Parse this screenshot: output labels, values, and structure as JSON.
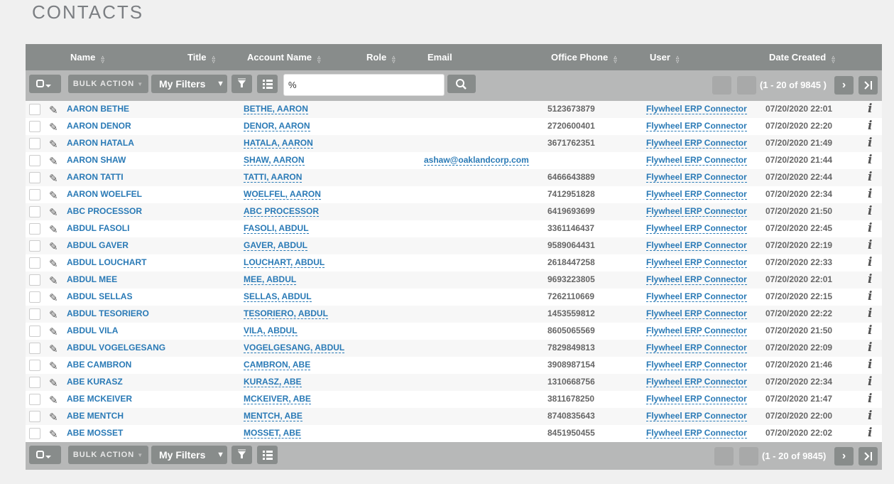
{
  "page": {
    "title": "CONTACTS"
  },
  "columns": [
    "Name",
    "Title",
    "Account Name",
    "Role",
    "Email",
    "Office Phone",
    "User",
    "Date Created"
  ],
  "toolbar": {
    "bulk_action": "BULK ACTION",
    "my_filters": "My Filters",
    "search_value": "%",
    "pagination_top": "(1 - 20 of 9845 )",
    "pagination_bottom": "(1 - 20 of 9845)"
  },
  "rows": [
    {
      "name": "AARON BETHE",
      "account": "BETHE, AARON",
      "email": "",
      "phone": "5123673879",
      "user": "Flywheel ERP Connector",
      "date": "07/20/2020 22:01"
    },
    {
      "name": "AARON DENOR",
      "account": "DENOR, AARON",
      "email": "",
      "phone": "2720600401",
      "user": "Flywheel ERP Connector",
      "date": "07/20/2020 22:20"
    },
    {
      "name": "AARON HATALA",
      "account": "HATALA, AARON",
      "email": "",
      "phone": "3671762351",
      "user": "Flywheel ERP Connector",
      "date": "07/20/2020 21:49"
    },
    {
      "name": "AARON SHAW",
      "account": "SHAW, AARON",
      "email": "ashaw@oaklandcorp.com",
      "phone": "",
      "user": "Flywheel ERP Connector",
      "date": "07/20/2020 21:44"
    },
    {
      "name": "AARON TATTI",
      "account": "TATTI, AARON",
      "email": "",
      "phone": "6466643889",
      "user": "Flywheel ERP Connector",
      "date": "07/20/2020 22:44"
    },
    {
      "name": "AARON WOELFEL",
      "account": "WOELFEL, AARON",
      "email": "",
      "phone": "7412951828",
      "user": "Flywheel ERP Connector",
      "date": "07/20/2020 22:34"
    },
    {
      "name": "ABC PROCESSOR",
      "account": "ABC PROCESSOR",
      "email": "",
      "phone": "6419693699",
      "user": "Flywheel ERP Connector",
      "date": "07/20/2020 21:50"
    },
    {
      "name": "ABDUL FASOLI",
      "account": "FASOLI, ABDUL",
      "email": "",
      "phone": "3361146437",
      "user": "Flywheel ERP Connector",
      "date": "07/20/2020 22:45"
    },
    {
      "name": "ABDUL GAVER",
      "account": "GAVER, ABDUL",
      "email": "",
      "phone": "9589064431",
      "user": "Flywheel ERP Connector",
      "date": "07/20/2020 22:19"
    },
    {
      "name": "ABDUL LOUCHART",
      "account": "LOUCHART, ABDUL",
      "email": "",
      "phone": "2618447258",
      "user": "Flywheel ERP Connector",
      "date": "07/20/2020 22:33"
    },
    {
      "name": "ABDUL MEE",
      "account": "MEE, ABDUL",
      "email": "",
      "phone": "9693223805",
      "user": "Flywheel ERP Connector",
      "date": "07/20/2020 22:01"
    },
    {
      "name": "ABDUL SELLAS",
      "account": "SELLAS, ABDUL",
      "email": "",
      "phone": "7262110669",
      "user": "Flywheel ERP Connector",
      "date": "07/20/2020 22:15"
    },
    {
      "name": "ABDUL TESORIERO",
      "account": "TESORIERO, ABDUL",
      "email": "",
      "phone": "1453559812",
      "user": "Flywheel ERP Connector",
      "date": "07/20/2020 22:22"
    },
    {
      "name": "ABDUL VILA",
      "account": "VILA, ABDUL",
      "email": "",
      "phone": "8605065569",
      "user": "Flywheel ERP Connector",
      "date": "07/20/2020 21:50"
    },
    {
      "name": "ABDUL VOGELGESANG",
      "account": "VOGELGESANG, ABDUL",
      "email": "",
      "phone": "7829849813",
      "user": "Flywheel ERP Connector",
      "date": "07/20/2020 22:09"
    },
    {
      "name": "ABE CAMBRON",
      "account": "CAMBRON, ABE",
      "email": "",
      "phone": "3908987154",
      "user": "Flywheel ERP Connector",
      "date": "07/20/2020 21:46"
    },
    {
      "name": "ABE KURASZ",
      "account": "KURASZ, ABE",
      "email": "",
      "phone": "1310668756",
      "user": "Flywheel ERP Connector",
      "date": "07/20/2020 22:34"
    },
    {
      "name": "ABE MCKEIVER",
      "account": "MCKEIVER, ABE",
      "email": "",
      "phone": "3811678250",
      "user": "Flywheel ERP Connector",
      "date": "07/20/2020 21:47"
    },
    {
      "name": "ABE MENTCH",
      "account": "MENTCH, ABE",
      "email": "",
      "phone": "8740835643",
      "user": "Flywheel ERP Connector",
      "date": "07/20/2020 22:00"
    },
    {
      "name": "ABE MOSSET",
      "account": "MOSSET, ABE",
      "email": "",
      "phone": "8451950455",
      "user": "Flywheel ERP Connector",
      "date": "07/20/2020 22:02"
    }
  ]
}
